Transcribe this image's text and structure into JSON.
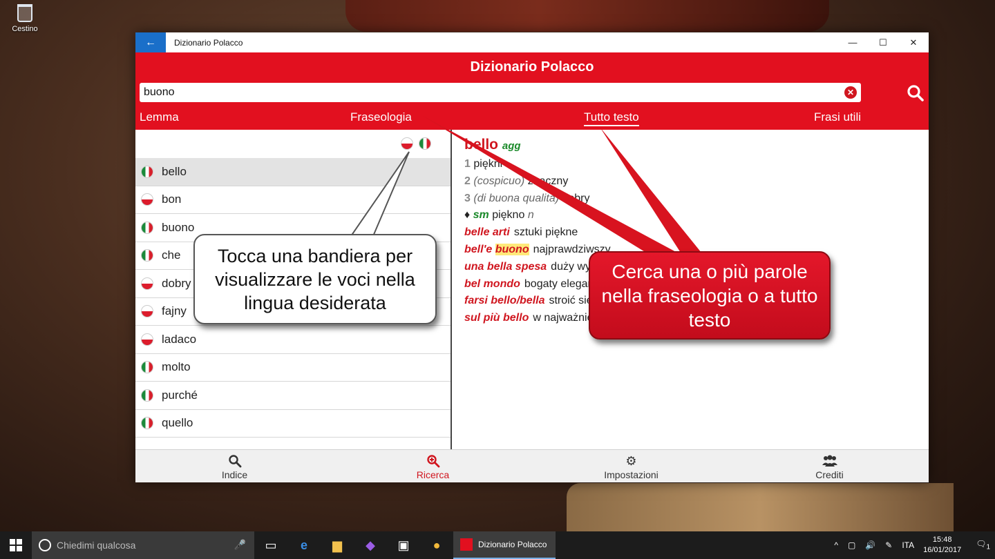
{
  "desktop": {
    "recycle_bin_label": "Cestino"
  },
  "window": {
    "title": "Dizionario Polacco",
    "back_icon": "arrow-left",
    "controls": [
      "—",
      "☐",
      "✕"
    ]
  },
  "header": {
    "title": "Dizionario Polacco",
    "search_value": "buono",
    "tabs": [
      "Lemma",
      "Fraseologia",
      "Tutto testo",
      "Frasi utili"
    ],
    "active_tab": "Tutto testo",
    "accent": "#e2101f"
  },
  "word_list": [
    {
      "lang": "it",
      "word": "bello",
      "selected": true
    },
    {
      "lang": "pl",
      "word": "bon"
    },
    {
      "lang": "it",
      "word": "buono"
    },
    {
      "lang": "it",
      "word": "che"
    },
    {
      "lang": "pl",
      "word": "dobry"
    },
    {
      "lang": "pl",
      "word": "fajny"
    },
    {
      "lang": "pl",
      "word": "ladaco"
    },
    {
      "lang": "it",
      "word": "molto"
    },
    {
      "lang": "it",
      "word": "purché"
    },
    {
      "lang": "it",
      "word": "quello"
    }
  ],
  "entry": {
    "headword": "bello",
    "pos": "agg",
    "sense1_num": "1",
    "sense1": "piękni",
    "sense2_num": "2",
    "sense2_paren": "(cospicuo)",
    "sense2": "znaczny",
    "sense3_num": "3",
    "sense3_paren": "(di buona qualità)",
    "sense3": "dobry",
    "sm_marker": "♦",
    "sm_label": "sm",
    "sm_trans": "piękno",
    "sm_gender": "n",
    "phrases": [
      {
        "it": "belle arti",
        "pl": "sztuki piękne"
      },
      {
        "it_pre": "bell'e ",
        "it_hl": "buono",
        "pl": "najprawdziwszy"
      },
      {
        "it": "una bella spesa",
        "pl": "duży wydatek"
      },
      {
        "it": "bel mondo",
        "pl": "bogaty elegancki świat"
      },
      {
        "it": "farsi bello/bella",
        "pl": "stroić się"
      },
      {
        "it": "sul più bello",
        "pl": "w najważniejszym momencie"
      }
    ]
  },
  "bottom_nav": [
    {
      "label": "Indice",
      "icon": "search-icon"
    },
    {
      "label": "Ricerca",
      "icon": "zoom-in-icon",
      "active": true
    },
    {
      "label": "Impostazioni",
      "icon": "gear-icon"
    },
    {
      "label": "Crediti",
      "icon": "people-icon"
    }
  ],
  "callouts": {
    "flags": "Tocca una bandiera per visualizzare le voci nella lingua desiderata",
    "search": "Cerca una o più parole nella fraseologia o a tutto testo"
  },
  "taskbar": {
    "search_placeholder": "Chiedimi qualcosa",
    "app_label": "Dizionario Polacco",
    "lang": "ITA",
    "time": "15:48",
    "date": "16/01/2017",
    "notifications": "1"
  }
}
